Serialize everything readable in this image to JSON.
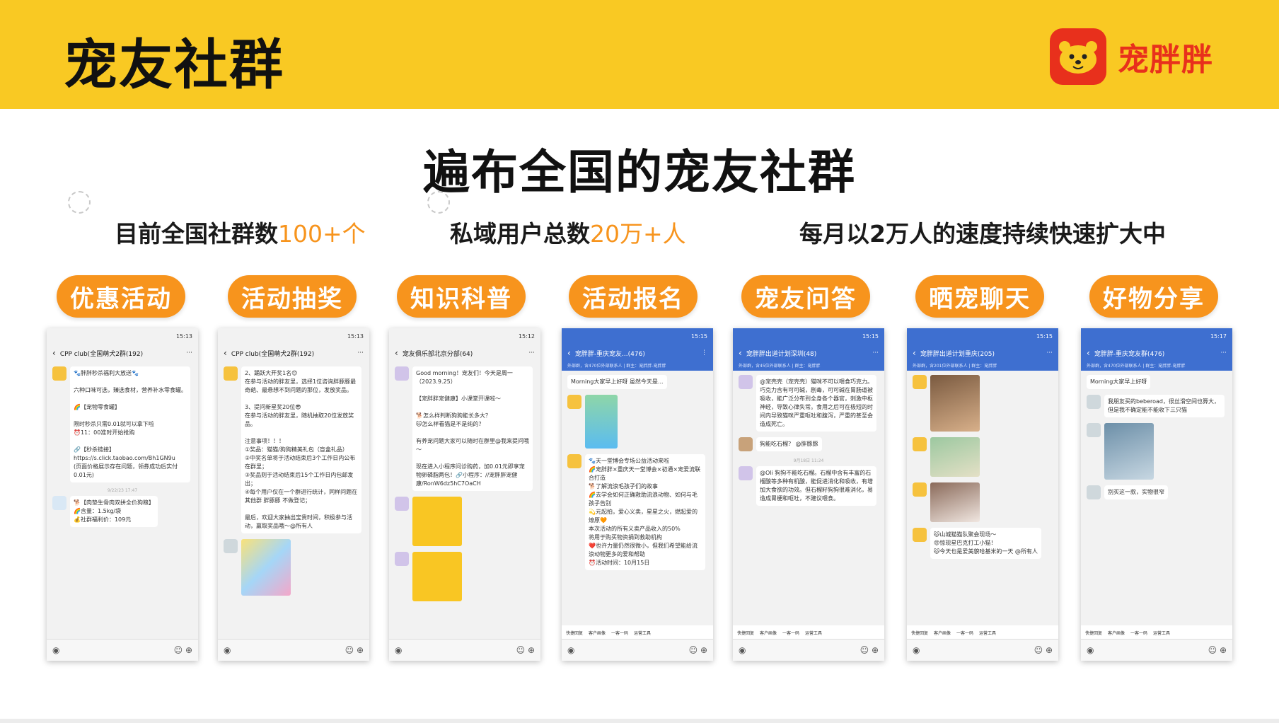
{
  "header": {
    "title": "宠友社群",
    "brand_name": "宠胖胖",
    "accent_color": "#f9c923",
    "brand_color": "#e8301c"
  },
  "headline": "遍布全国的宠友社群",
  "stats": [
    {
      "prefix": "目前全国社群数",
      "highlight": "100+个",
      "suffix": ""
    },
    {
      "prefix": "私域用户总数",
      "highlight": "20万+人",
      "suffix": ""
    },
    {
      "prefix": "每月以2万人的速度持续快速扩大中",
      "highlight": "",
      "suffix": ""
    }
  ],
  "highlight_color": "#f7941d",
  "categories": [
    "优惠活动",
    "活动抽奖",
    "知识科普",
    "活动报名",
    "宠友问答",
    "晒宠聊天",
    "好物分享"
  ],
  "screenshots": [
    {
      "time": "15:13",
      "title": "CPP club(全国萌犬2群(192)",
      "messages": [
        "🐾胖胖秒杀福利大放送🐾\n\n六种口味可选，臻选食材，营养补水零食罐。\n\n🌈【宠物零食罐】\n\n限时秒杀只需0.01就可以拿下啦\n⏰11：00准时开始抢购\n\n🔗【秒杀链接】https://s.click.taobao.com/Bh1GN9u\n(页面价格展示存在问题，领券成功后实付0.01元)",
        "🐕【肉垫生骨肉双拼全价狗粮】\n🌈含量：1.5kg/袋\n💰社群福利价：109元"
      ],
      "time_stamp": "9/22/23 17:47"
    },
    {
      "time": "15:13",
      "title": "CPP club(全国萌犬2群(192)",
      "messages": [
        "2、踊跃大开奖1名😊\n在参与活动的胖友里，选择1位咨询胖豚豚最奇葩、最悬想不到问题的那位，发放奖品。\n\n3、提问新星奖20位😎\n在参与活动的胖友里，随机抽取20位发放奖品。\n\n注意事项！！！\n①奖品：猫猫/狗狗精美礼包（盲盒礼品）\n②中奖名单将于活动结束后3个工作日内公布在群里；\n③奖品则于活动结束后15个工作日内包邮发出；\n④每个用户仅在一个群进行统计，同样问题在其他群 胖豚豚 不做登记；\n\n最后，欢迎大家抽出宝贵时间，积极参与活动，赢取奖品哦～@所有人"
      ]
    },
    {
      "time": "15:12",
      "title": "宠友俱乐部北京分部(64)",
      "messages": [
        "Good morning！宠友们！今天是周一（2023.9.25）\n\n【宠胖胖宠健康】小课堂开课啦～\n\n🐕怎么样判断狗狗能长多大？\n🐱怎么样看猫是不是纯的？\n\n有养宠问题大家可以随时在群里@我来提问哦～\n\n现在进入小程序问诊购药，加0.01元即享宠物卵磷脂两包！🔗小程序：//宠胖胖宠健康/RonW6dz5hC7OaCH"
      ]
    },
    {
      "time": "15:15",
      "title": "宠胖胖-重庆宠友...(476)",
      "blue": true,
      "sub": "外部群，含470位外部联系人 | 群主：宠胖胖-宠胖胖",
      "messages": [
        "Morning大家早上好呀 虽然今天是...",
        "🐾天一堂博会专场公益活动来啦\n🌈宠胖胖×重庆天一堂博会×初通×宠爱流联合打造\n🐕了解流浪毛孩子们的故事\n🌈去学会如何正确救助流浪动物、如何与毛孩子告别\n💫元起拍，爱心义卖，星星之火，燃起爱的燎原🧡\n本次活动的所有义卖产品收入的50%\n将用于购买物资捐到救助机构\n❤️也许力量仍然很微小，但我们希望能给流浪动物更多的爱和帮助\n⏰活动时间：10月15日"
      ]
    },
    {
      "time": "15:15",
      "title": "宠胖胖出道计划深圳(48)",
      "blue": true,
      "sub": "外部群，含45位外部联系人 | 群主：宠胖胖",
      "messages": [
        "@宠壳壳（宠壳壳）猫咪不可以喂食巧克力。巧克力含有可可碱，剧毒，可可碱在胃肠道被吸收，能广泛分布到全身各个器官，刺激中枢神经，导致心律失常。食用之后可在极短的时间内导致猫咪严重呕吐和腹泻，严重的甚至会造成死亡。",
        "狗能吃石榴？ @胖豚豚",
        "@Oli 狗狗不能吃石榴。石榴中含有丰富的石榴酸等多种有机酸，能促进消化和吸收，有增加大食欲的功效。但石榴籽狗狗很难消化，易造成胃梗和呕吐，不建议喂食。"
      ],
      "time_stamp": "9月18日 11:24"
    },
    {
      "time": "15:15",
      "title": "宠胖胖出道计划重庆(205)",
      "blue": true,
      "sub": "外部群，含201位外部联系人 | 群主：宠胖胖",
      "messages": [
        "🐱山城猫猫队聚会现场～\n😍惊现星巴克打工小猫！\n🐱今天也是爱美貌哈基米的一天 @所有人"
      ]
    },
    {
      "time": "15:17",
      "title": "宠胖胖-重庆宠友群(476)",
      "blue": true,
      "sub": "外部群，含470位外部联系人 | 群主：宠胖胖-宠胖胖",
      "messages": [
        "Morning大家早上好呀",
        "我朋友买的beberoad，很丝滑空间也算大，但是我不确定能不能收下三只猫",
        "别买这一款，实物很窄"
      ]
    }
  ],
  "quick_actions": [
    "快捷回复",
    "客户画像",
    "一客一码",
    "运营工具"
  ]
}
